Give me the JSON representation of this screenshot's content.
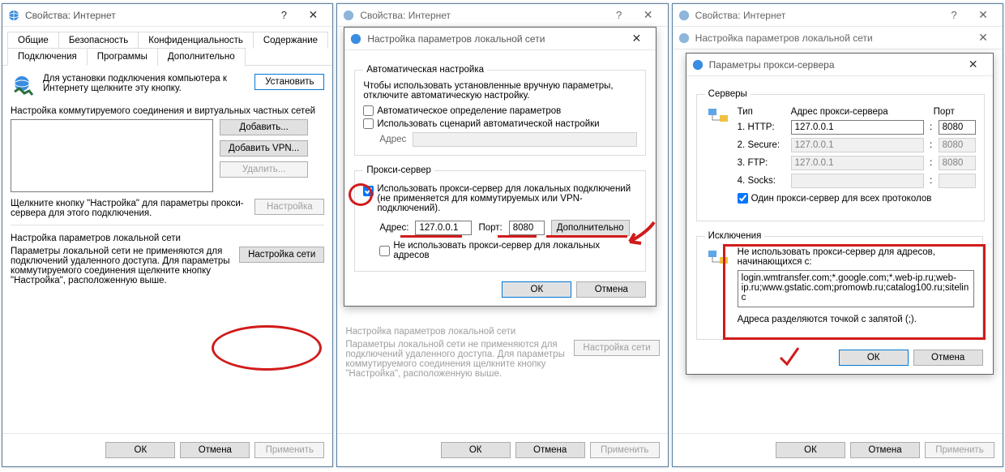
{
  "win1": {
    "title": "Свойства: Интернет",
    "tabs": {
      "general": "Общие",
      "security": "Безопасность",
      "privacy": "Конфиденциальность",
      "content": "Содержание",
      "connections": "Подключения",
      "programs": "Программы",
      "advanced": "Дополнительно"
    },
    "setup_text": "Для установки подключения компьютера к Интернету щелкните эту кнопку.",
    "setup_btn": "Установить",
    "dial_heading": "Настройка коммутируемого соединения и виртуальных частных сетей",
    "add_btn": "Добавить...",
    "add_vpn_btn": "Добавить VPN...",
    "remove_btn": "Удалить...",
    "settings_btn": "Настройка",
    "proxy_hint": "Щелкните кнопку \"Настройка\" для параметры прокси-сервера для этого подключения.",
    "lan_fieldset": "Настройка параметров локальной сети",
    "lan_text": "Параметры локальной сети не применяются для подключений удаленного доступа. Для параметры коммутируемого соединения щелкните кнопку \"Настройка\", расположенную выше.",
    "lan_btn": "Настройка сети",
    "ok": "ОК",
    "cancel": "Отмена",
    "apply": "Применить"
  },
  "lan_dialog": {
    "title": "Настройка параметров локальной сети",
    "auto_legend": "Автоматическая настройка",
    "auto_desc": "Чтобы использовать установленные вручную параметры, отключите автоматическую настройку.",
    "auto_detect": "Автоматическое определение параметров",
    "use_script": "Использовать сценарий автоматической настройки",
    "address_label": "Адрес",
    "proxy_legend": "Прокси-сервер",
    "use_proxy": "Использовать прокси-сервер для локальных подключений (не применяется для коммутируемых или VPN-подключений).",
    "addr_label": "Адрес:",
    "addr_value": "127.0.0.1",
    "port_label": "Порт:",
    "port_value": "8080",
    "adv_btn": "Дополнительно",
    "bypass_local": "Не использовать прокси-сервер для локальных адресов",
    "ok": "ОК",
    "cancel": "Отмена"
  },
  "win2": {
    "title": "Свойства: Интернет",
    "lan_fieldset": "Настройка параметров локальной сети",
    "lan_text": "Параметры локальной сети не применяются для подключений удаленного доступа. Для параметры коммутируемого соединения щелкните кнопку \"Настройка\", расположенную выше.",
    "lan_btn": "Настройка сети",
    "ok": "ОК",
    "cancel": "Отмена",
    "apply": "Применить"
  },
  "win3": {
    "title": "Свойства: Интернет",
    "subtitle": "Настройка параметров локальной сети",
    "ok": "ОК",
    "cancel": "Отмена",
    "apply": "Применить"
  },
  "adv_dialog": {
    "title": "Параметры прокси-сервера",
    "servers_legend": "Серверы",
    "hdr_type": "Тип",
    "hdr_addr": "Адрес прокси-сервера",
    "hdr_port": "Порт",
    "rows": {
      "http": {
        "label": "1. HTTP:",
        "addr": "127.0.0.1",
        "port": "8080"
      },
      "secure": {
        "label": "2. Secure:",
        "addr": "127.0.0.1",
        "port": "8080"
      },
      "ftp": {
        "label": "3. FTP:",
        "addr": "127.0.0.1",
        "port": "8080"
      },
      "socks": {
        "label": "4. Socks:",
        "addr": "",
        "port": ""
      }
    },
    "same_for_all": "Один прокси-сервер для всех протоколов",
    "exceptions_legend": "Исключения",
    "exceptions_desc": "Не использовать прокси-сервер для адресов, начинающихся с:",
    "exceptions_value": "login.wmtransfer.com;*.google.com;*.web-ip.ru;web-ip.ru;www.gstatic.com;promowb.ru;catalog100.ru;sitelinc",
    "separator_hint": "Адреса разделяются точкой с запятой (;).",
    "ok": "ОК",
    "cancel": "Отмена"
  }
}
